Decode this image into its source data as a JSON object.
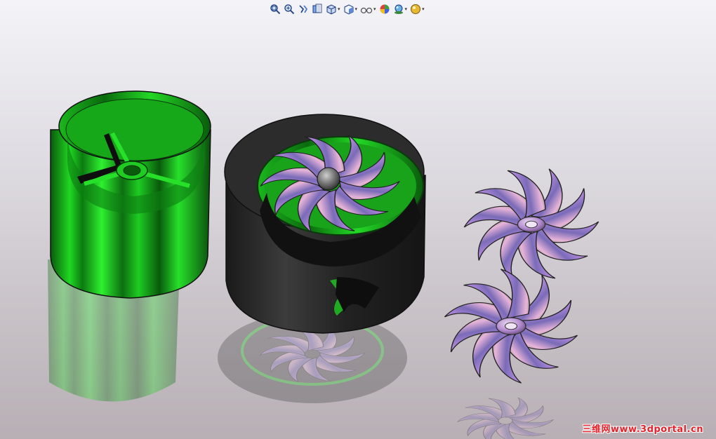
{
  "toolbar": {
    "buttons": [
      {
        "name": "zoom-to-fit-icon",
        "caret": false
      },
      {
        "name": "zoom-to-area-icon",
        "caret": false
      },
      {
        "name": "previous-view-icon",
        "caret": false
      },
      {
        "name": "section-view-icon",
        "caret": false
      },
      {
        "name": "view-orientation-icon",
        "caret": true
      },
      {
        "name": "display-style-icon",
        "caret": true
      },
      {
        "name": "hide-show-items-icon",
        "caret": true
      },
      {
        "name": "edit-appearance-icon",
        "caret": false
      },
      {
        "name": "apply-scene-icon",
        "caret": true
      },
      {
        "name": "view-settings-icon",
        "caret": true
      }
    ],
    "caret_glyph": "▾"
  },
  "watermark": {
    "text": "三维网www.3dportal.cn",
    "color": "#e8202a"
  },
  "colors": {
    "housing_green": "#18c21c",
    "shroud_black": "#2a2a2a",
    "blade_purple": "#c8a0e8"
  }
}
